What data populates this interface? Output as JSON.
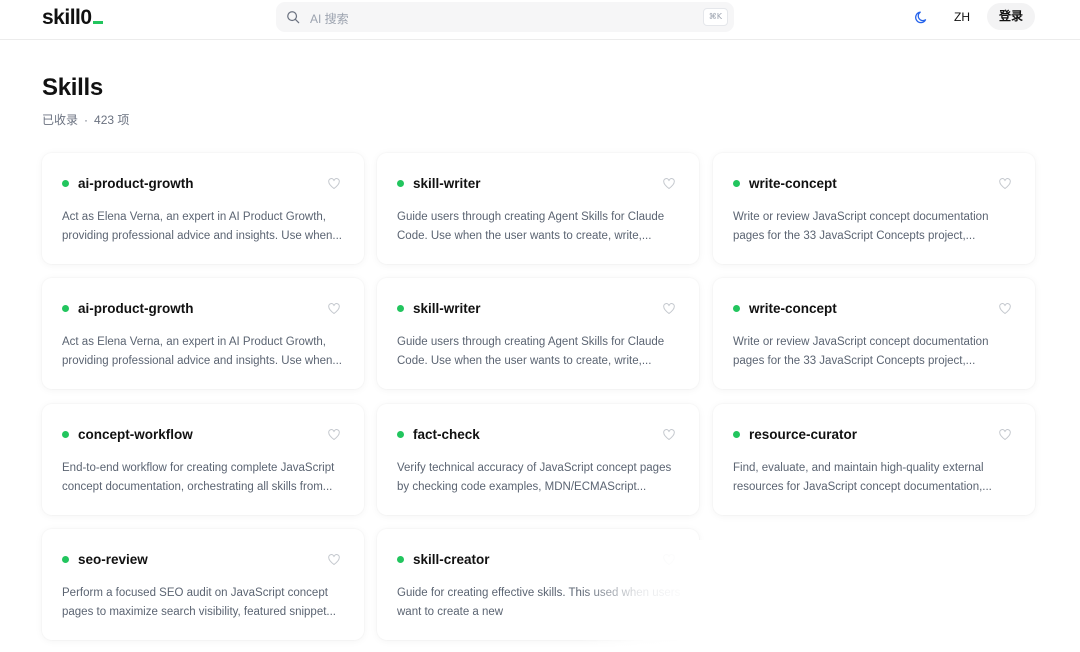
{
  "header": {
    "logo": "skill0",
    "search_placeholder": "AI 搜索",
    "search_shortcut": "⌘K",
    "theme_icon": "moon-icon",
    "lang": "ZH",
    "login": "登录"
  },
  "page": {
    "title": "Skills",
    "collected_label": "已收录",
    "separator": "·",
    "count": "423 项"
  },
  "skills": [
    {
      "name": "ai-product-growth",
      "desc": "Act as Elena Verna, an expert in AI Product Growth, providing professional advice and insights. Use when..."
    },
    {
      "name": "skill-writer",
      "desc": "Guide users through creating Agent Skills for Claude Code. Use when the user wants to create, write,..."
    },
    {
      "name": "write-concept",
      "desc": "Write or review JavaScript concept documentation pages for the 33 JavaScript Concepts project,..."
    },
    {
      "name": "ai-product-growth",
      "desc": "Act as Elena Verna, an expert in AI Product Growth, providing professional advice and insights. Use when..."
    },
    {
      "name": "skill-writer",
      "desc": "Guide users through creating Agent Skills for Claude Code. Use when the user wants to create, write,..."
    },
    {
      "name": "write-concept",
      "desc": "Write or review JavaScript concept documentation pages for the 33 JavaScript Concepts project,..."
    },
    {
      "name": "concept-workflow",
      "desc": "End-to-end workflow for creating complete JavaScript concept documentation, orchestrating all skills from..."
    },
    {
      "name": "fact-check",
      "desc": "Verify technical accuracy of JavaScript concept pages by checking code examples, MDN/ECMAScript..."
    },
    {
      "name": "resource-curator",
      "desc": "Find, evaluate, and maintain high-quality external resources for JavaScript concept documentation,..."
    },
    {
      "name": "seo-review",
      "desc": "Perform a focused SEO audit on JavaScript concept pages to maximize search visibility, featured snippet..."
    },
    {
      "name": "skill-creator",
      "desc": "Guide for creating effective skills. This used when users want to create a new"
    }
  ],
  "colors": {
    "status": "#22c55e",
    "text": "#111111",
    "muted": "#6b7280"
  }
}
